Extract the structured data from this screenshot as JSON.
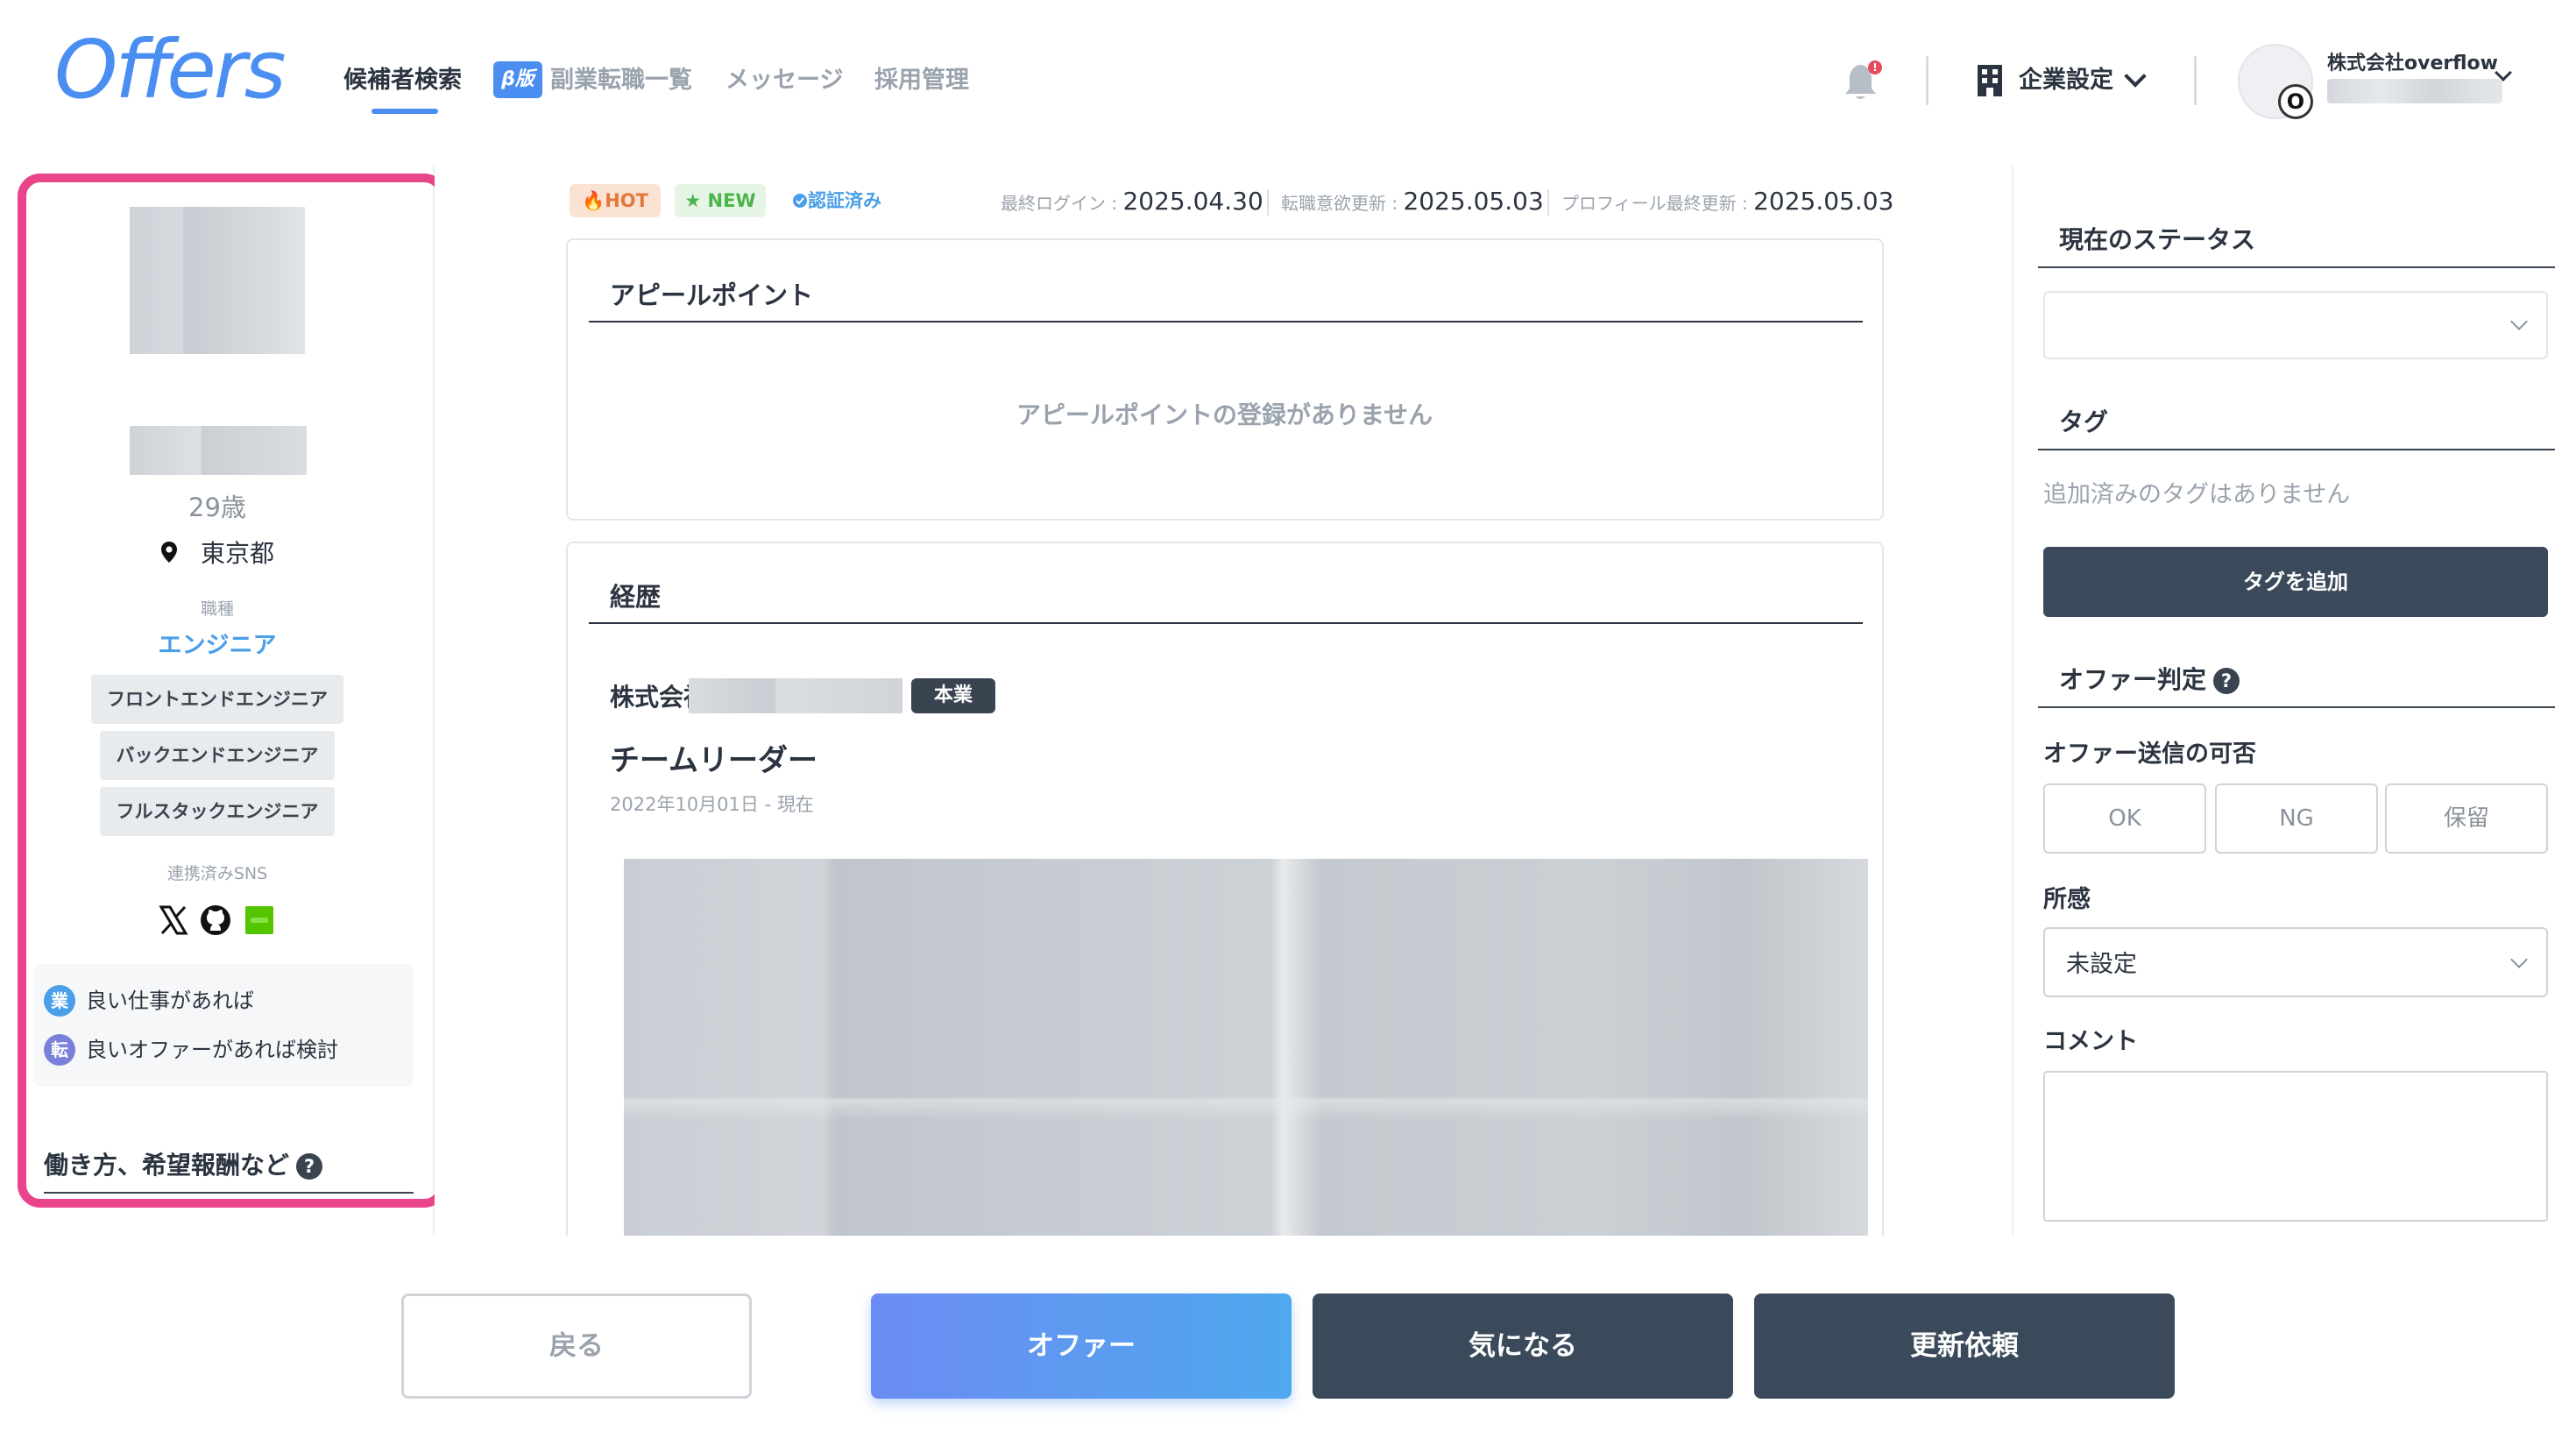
{
  "header": {
    "logo": "Offers",
    "nav": [
      "候補者検索",
      "副業転職一覧",
      "メッセージ",
      "採用管理"
    ],
    "beta_label": "β版",
    "company_settings": "企業設定",
    "company_name": "株式会社overflow",
    "notification_badge": "!"
  },
  "profile": {
    "age": "29歳",
    "location": "東京都",
    "job_label": "職種",
    "job_type": "エンジニア",
    "skills": [
      "フロントエンドエンジニア",
      "バックエンドエンジニア",
      "フルスタックエンジニア"
    ],
    "sns_label": "連携済みSNS",
    "sns": [
      "x-icon",
      "github-icon",
      "qiita-icon"
    ],
    "intent": [
      {
        "badge": "業",
        "text": "良い仕事があれば",
        "color": "#4b9fe8"
      },
      {
        "badge": "転",
        "text": "良いオファーがあれば検討",
        "color": "#7a7fd9"
      }
    ],
    "work_style_title": "働き方、希望報酬など",
    "help": "?"
  },
  "center": {
    "badges": {
      "hot": "HOT",
      "new": "NEW",
      "verified": "認証済み"
    },
    "meta": [
      {
        "label": "最終ログイン : ",
        "value": "2025.04.30"
      },
      {
        "label": "転職意欲更新 : ",
        "value": "2025.05.03"
      },
      {
        "label": "プロフィール最終更新 : ",
        "value": "2025.05.03"
      }
    ],
    "appeal_title": "アピールポイント",
    "appeal_empty": "アピールポイントの登録がありません",
    "history_title": "経歴",
    "company_prefix": "株式会社",
    "employment_type": "本業",
    "role": "チームリーダー",
    "period": "2022年10月01日 - 現在"
  },
  "right": {
    "status_title": "現在のステータス",
    "tag_title": "タグ",
    "tag_empty": "追加済みのタグはありません",
    "add_tag": "タグを追加",
    "offer_judge_title": "オファー判定",
    "offer_send_label": "オファー送信の可否",
    "judge_options": [
      "OK",
      "NG",
      "保留"
    ],
    "impression_label": "所感",
    "impression_value": "未設定",
    "comment_label": "コメント"
  },
  "footer": {
    "back": "戻る",
    "offer": "オファー",
    "interested": "気になる",
    "update_request": "更新依頼"
  }
}
